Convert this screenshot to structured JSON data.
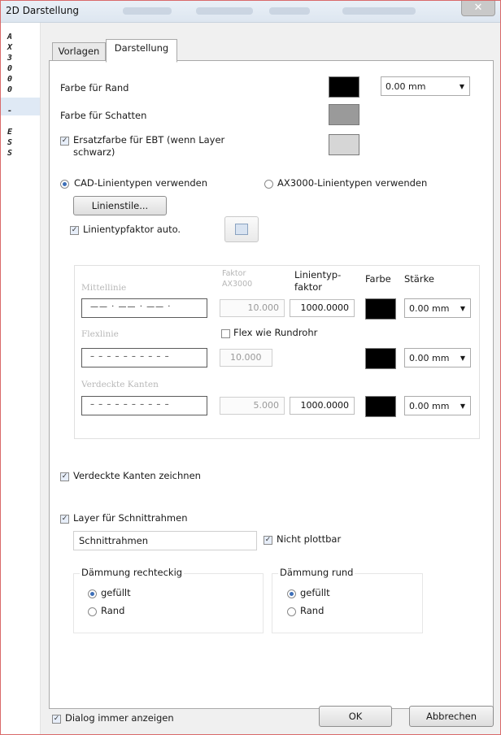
{
  "window": {
    "title": "2D Darstellung",
    "close_label": "✕"
  },
  "left_strip": {
    "chars": [
      "A",
      "X",
      "3",
      "0",
      "0",
      "0",
      "-",
      "E",
      "S",
      "S"
    ]
  },
  "tabs": [
    {
      "label": "Vorlagen"
    },
    {
      "label": "Darstellung"
    }
  ],
  "colors": {
    "rand": {
      "label": "Farbe für Rand",
      "color": "#000000"
    },
    "schatten": {
      "label": "Farbe für Schatten",
      "color": "#9a9a9a"
    },
    "ersatz": {
      "label_line1": "Ersatzfarbe für EBT (wenn Layer",
      "label_line2": "schwarz)",
      "checked": true,
      "color": "#d6d6d6"
    },
    "rand_width": "0.00 mm"
  },
  "linetypes": {
    "cad_label": "CAD-Linientypen verwenden",
    "ax_label": "AX3000-Linientypen verwenden",
    "selected": "cad",
    "linienstile_button": "Linienstile...",
    "faktor_auto_label": "Linientypfaktor auto.",
    "faktor_auto_checked": true
  },
  "linegroup": {
    "headers": {
      "faktor_ax_line1": "Faktor",
      "faktor_ax_line2": "AX3000",
      "lt_faktor_line1": "Linientyp-",
      "lt_faktor_line2": "faktor",
      "farbe": "Farbe",
      "staerke": "Stärke"
    },
    "rows": [
      {
        "name": "Mittellinie",
        "pattern": "—— · —— · —— ·",
        "faktor_ax": "10.000",
        "lt_faktor": "1000.0000",
        "staerke": "0.00 mm"
      },
      {
        "name": "Flexlinie",
        "pattern": "– – – – – – – – – –",
        "faktor_ax": "10.000",
        "flex_label": "Flex wie Rundrohr",
        "flex_checked": false,
        "staerke": "0.00 mm"
      },
      {
        "name": "Verdeckte Kanten",
        "pattern": "– – – – – – – – – –",
        "faktor_ax": "5.000",
        "lt_faktor": "1000.0000",
        "staerke": "0.00 mm"
      }
    ]
  },
  "verdeckte_kanten": {
    "label": "Verdeckte Kanten zeichnen",
    "checked": true
  },
  "schnittrahmen": {
    "label": "Layer für Schnittrahmen",
    "checked": true,
    "layer_value": "Schnittrahmen",
    "nicht_plottbar_label": "Nicht plottbar",
    "nicht_plottbar_checked": true,
    "rechteckig": {
      "title": "Dämmung rechteckig",
      "opt1": "gefüllt",
      "opt2": "Rand",
      "selected": 1
    },
    "rund": {
      "title": "Dämmung rund",
      "opt1": "gefüllt",
      "opt2": "Rand",
      "selected": 1
    }
  },
  "footer": {
    "dialog_label": "Dialog immer anzeigen",
    "dialog_checked": true,
    "ok_label": "OK",
    "cancel_label": "Abbrechen"
  }
}
